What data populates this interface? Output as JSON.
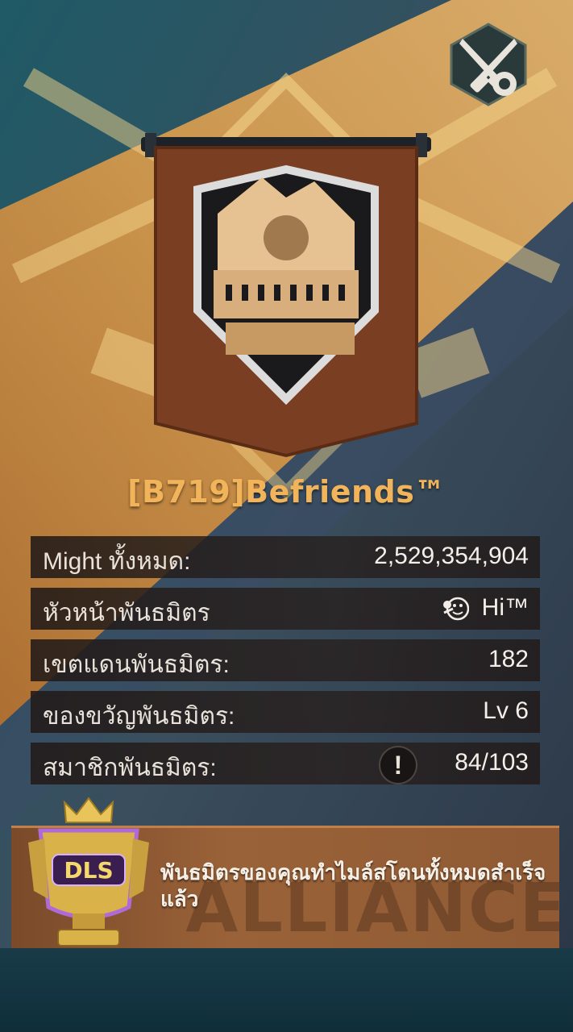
{
  "alliance": {
    "name": "[B719]Befriends™"
  },
  "stats": [
    {
      "label": "Might ทั้งหมด:",
      "value": "2,529,354,904"
    },
    {
      "label": "หัวหน้าพันธมิตร",
      "value": "Hi™"
    },
    {
      "label": "เขตแดนพันธมิตร:",
      "value": "182"
    },
    {
      "label": "ของขวัญพันธมิตร:",
      "value": "Lv 6"
    },
    {
      "label": "สมาชิกพันธมิตร:",
      "value": "84/103",
      "alert": "!"
    }
  ],
  "footer": {
    "message": "พันธมิตรของคุณทำไมล์สโตนทั้งหมดสำเร็จแล้ว",
    "watermark": "ALLIANCE",
    "trophy_text": "DLS"
  },
  "icons": {
    "settings": "crossed-knives-gear-icon",
    "leader": "rose-icon",
    "alert": "exclamation-icon"
  },
  "colors": {
    "name": "#f1b45a",
    "banner": "#7a3f22",
    "stripe": "#d89a4a"
  }
}
